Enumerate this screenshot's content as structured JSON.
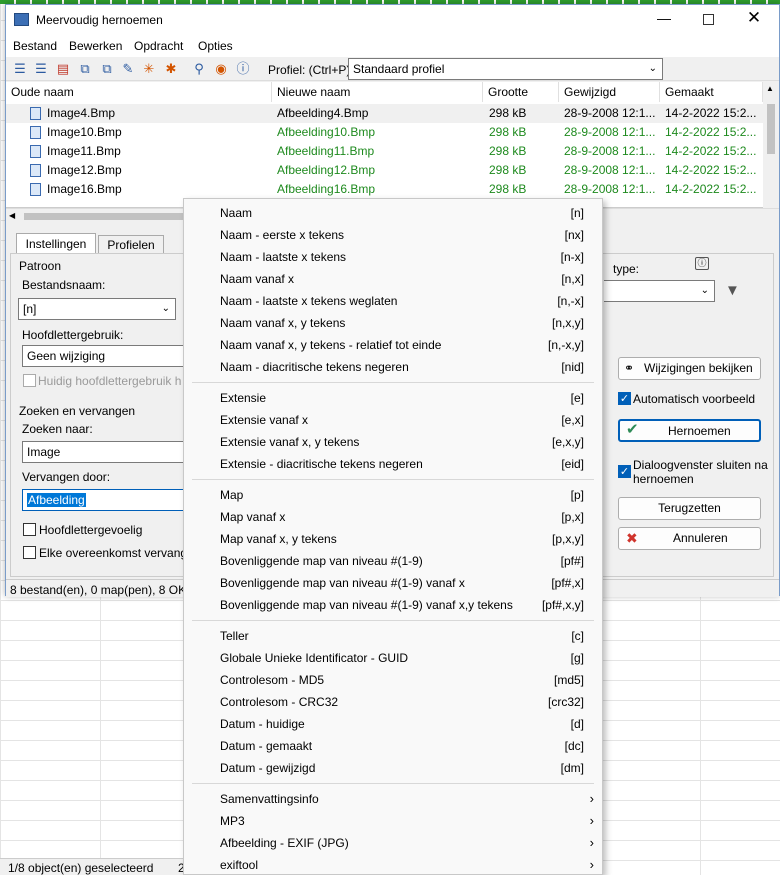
{
  "window": {
    "title": "Meervoudig hernoemen"
  },
  "menu": [
    "Bestand",
    "Bewerken",
    "Opdracht",
    "Opties"
  ],
  "toolbar": {
    "profile_label": "Profiel: (Ctrl+P)",
    "profile_value": "Standaard profiel"
  },
  "columns": [
    "Oude naam",
    "Nieuwe naam",
    "Grootte",
    "Gewijzigd",
    "Gemaakt"
  ],
  "rows": [
    {
      "old": "Image4.Bmp",
      "new": "Afbeelding4.Bmp",
      "size": "298 kB",
      "modified": "28-9-2008 12:1...",
      "created": "14-2-2022 15:2..."
    },
    {
      "old": "Image10.Bmp",
      "new": "Afbeelding10.Bmp",
      "size": "298 kB",
      "modified": "28-9-2008 12:1...",
      "created": "14-2-2022 15:2..."
    },
    {
      "old": "Image11.Bmp",
      "new": "Afbeelding11.Bmp",
      "size": "298 kB",
      "modified": "28-9-2008 12:1...",
      "created": "14-2-2022 15:2..."
    },
    {
      "old": "Image12.Bmp",
      "new": "Afbeelding12.Bmp",
      "size": "298 kB",
      "modified": "28-9-2008 12:1...",
      "created": "14-2-2022 15:2..."
    },
    {
      "old": "Image16.Bmp",
      "new": "Afbeelding16.Bmp",
      "size": "298 kB",
      "modified": "28-9-2008 12:1...",
      "created": "14-2-2022 15:2..."
    }
  ],
  "tabs": [
    "Instellingen",
    "Profielen"
  ],
  "pattern": {
    "group": "Patroon",
    "filename_label": "Bestandsnaam:",
    "filename_value": "[n]",
    "case_label": "Hoofdlettergebruik:",
    "case_value": "Geen wijziging",
    "keep_case": "Huidig hoofdlettergebruik h"
  },
  "search": {
    "group": "Zoeken en vervangen",
    "find_label": "Zoeken naar:",
    "find_value": "Image",
    "replace_label": "Vervangen door:",
    "replace_value": "Afbeelding",
    "case_sensitive": "Hoofdlettergevoelig",
    "each_match": "Elke overeenkomst vervang"
  },
  "right": {
    "type_label": "type:",
    "view_changes": "Wijzigingen bekijken",
    "auto_preview": "Automatisch voorbeeld",
    "rename": "Hernoemen",
    "close_dialog": "Dialoogvenster sluiten na hernoemen",
    "reset": "Terugzetten",
    "cancel": "Annuleren"
  },
  "status": {
    "text": "8 bestand(en), 0 map(pen), 8 OK",
    "bottom": "1/8 object(en) geselecteerd",
    "bottom_extra": "2"
  },
  "context_menu": {
    "groups": [
      [
        {
          "label": "Naam",
          "code": "[n]"
        },
        {
          "label": "Naam - eerste x tekens",
          "code": "[nx]"
        },
        {
          "label": "Naam - laatste x tekens",
          "code": "[n-x]"
        },
        {
          "label": "Naam vanaf x",
          "code": "[n,x]"
        },
        {
          "label": "Naam - laatste x tekens weglaten",
          "code": "[n,-x]"
        },
        {
          "label": "Naam vanaf x, y tekens",
          "code": "[n,x,y]"
        },
        {
          "label": "Naam vanaf x, y tekens - relatief tot einde",
          "code": "[n,-x,y]"
        },
        {
          "label": "Naam - diacritische tekens negeren",
          "code": "[nid]"
        }
      ],
      [
        {
          "label": "Extensie",
          "code": "[e]"
        },
        {
          "label": "Extensie vanaf x",
          "code": "[e,x]"
        },
        {
          "label": "Extensie vanaf x, y tekens",
          "code": "[e,x,y]"
        },
        {
          "label": "Extensie - diacritische tekens negeren",
          "code": "[eid]"
        }
      ],
      [
        {
          "label": "Map",
          "code": "[p]"
        },
        {
          "label": "Map vanaf x",
          "code": "[p,x]"
        },
        {
          "label": "Map vanaf x, y tekens",
          "code": "[p,x,y]"
        },
        {
          "label": "Bovenliggende map van niveau #(1-9)",
          "code": "[pf#]"
        },
        {
          "label": "Bovenliggende map van niveau #(1-9) vanaf x",
          "code": "[pf#,x]"
        },
        {
          "label": "Bovenliggende map van niveau #(1-9) vanaf x,y tekens",
          "code": "[pf#,x,y]"
        }
      ],
      [
        {
          "label": "Teller",
          "code": "[c]"
        },
        {
          "label": "Globale Unieke Identificator - GUID",
          "code": "[g]"
        },
        {
          "label": "Controlesom - MD5",
          "code": "[md5]"
        },
        {
          "label": "Controlesom - CRC32",
          "code": "[crc32]"
        },
        {
          "label": "Datum - huidige",
          "code": "[d]"
        },
        {
          "label": "Datum - gemaakt",
          "code": "[dc]"
        },
        {
          "label": "Datum - gewijzigd",
          "code": "[dm]"
        }
      ],
      [
        {
          "label": "Samenvattingsinfo",
          "submenu": true
        },
        {
          "label": "MP3",
          "submenu": true
        },
        {
          "label": "Afbeelding - EXIF (JPG)",
          "submenu": true
        },
        {
          "label": "exiftool",
          "submenu": true
        }
      ]
    ]
  }
}
